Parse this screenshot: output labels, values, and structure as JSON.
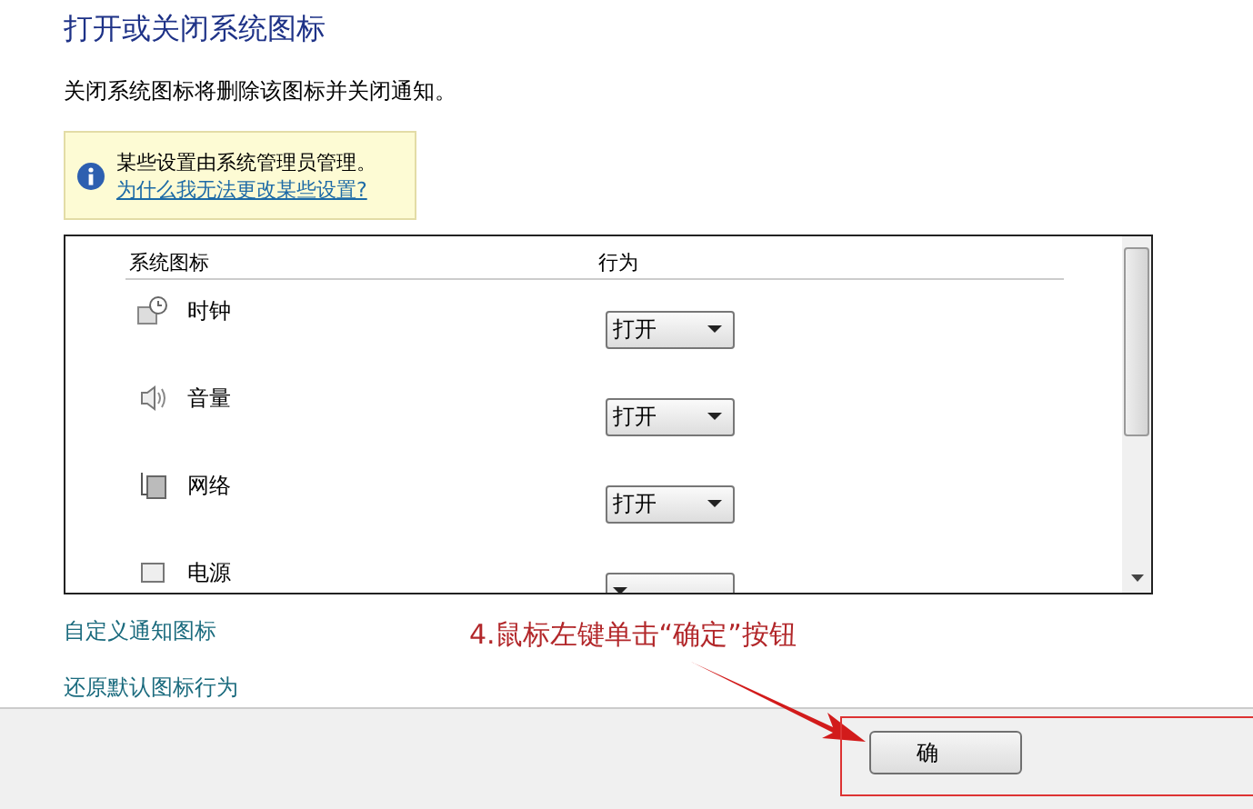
{
  "title": "打开或关闭系统图标",
  "description": "关闭系统图标将删除该图标并关闭通知。",
  "notice": {
    "text": "某些设置由系统管理员管理。",
    "link": "为什么我无法更改某些设置?"
  },
  "table": {
    "columns": [
      "系统图标",
      "行为"
    ],
    "rows": [
      {
        "kind": "clock",
        "name": "时钟",
        "behavior": "打开"
      },
      {
        "kind": "volume",
        "name": "音量",
        "behavior": "打开"
      },
      {
        "kind": "network",
        "name": "网络",
        "behavior": "打开"
      },
      {
        "kind": "power",
        "name": "电源",
        "behavior": ""
      }
    ]
  },
  "links": [
    "自定义通知图标",
    "还原默认图标行为"
  ],
  "annotation": "4.鼠标左键单击“确定”按钮",
  "buttons": [
    "确"
  ]
}
